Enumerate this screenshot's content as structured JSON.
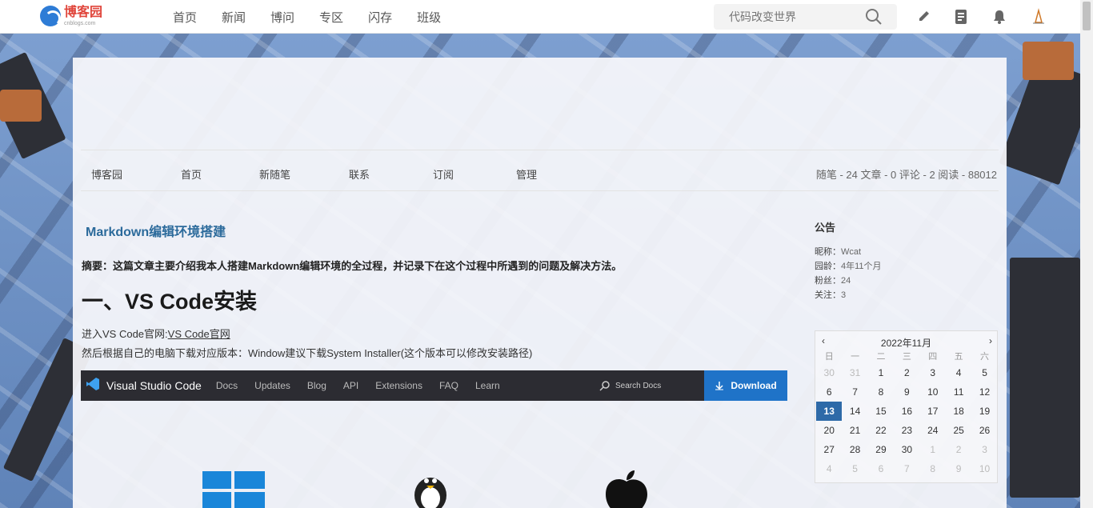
{
  "header": {
    "logo_cn": "博客园",
    "logo_en": "cnblogs.com",
    "nav": [
      "首页",
      "新闻",
      "博问",
      "专区",
      "闪存",
      "班级"
    ],
    "search_placeholder": "代码改变世界"
  },
  "blog_nav": {
    "items": [
      "博客园",
      "首页",
      "新随笔",
      "联系",
      "订阅",
      "管理"
    ],
    "stats": "随笔 - 24  文章 - 0  评论 - 2  阅读 - 88012"
  },
  "post": {
    "title": "Markdown编辑环境搭建",
    "abstract": "摘要：这篇文章主要介绍我本人搭建Markdown编辑环境的全过程，并记录下在这个过程中所遇到的问题及解决方法。",
    "heading": "一、VS Code安装",
    "line1_prefix": "进入VS Code官网:",
    "line1_link": "VS Code官网",
    "line2": "然后根据自己的电脑下载对应版本：Window建议下载System Installer(这个版本可以修改安装路径)"
  },
  "vscode_bar": {
    "title": "Visual Studio Code",
    "links": [
      "Docs",
      "Updates",
      "Blog",
      "API",
      "Extensions",
      "FAQ",
      "Learn"
    ],
    "search": "Search Docs",
    "download": "Download"
  },
  "sidebar": {
    "notice_title": "公告",
    "profile": [
      {
        "label": "昵称：",
        "value": "Wcat"
      },
      {
        "label": "园龄：",
        "value": "4年11个月"
      },
      {
        "label": "粉丝：",
        "value": "24"
      },
      {
        "label": "关注：",
        "value": "3"
      }
    ]
  },
  "calendar": {
    "prev": "‹",
    "next": "›",
    "month": "2022年11月",
    "weekdays": [
      "日",
      "一",
      "二",
      "三",
      "四",
      "五",
      "六"
    ],
    "weeks": [
      [
        "30",
        "31",
        "1",
        "2",
        "3",
        "4",
        "5"
      ],
      [
        "6",
        "7",
        "8",
        "9",
        "10",
        "11",
        "12"
      ],
      [
        "13",
        "14",
        "15",
        "16",
        "17",
        "18",
        "19"
      ],
      [
        "20",
        "21",
        "22",
        "23",
        "24",
        "25",
        "26"
      ],
      [
        "27",
        "28",
        "29",
        "30",
        "1",
        "2",
        "3"
      ],
      [
        "4",
        "5",
        "6",
        "7",
        "8",
        "9",
        "10"
      ]
    ],
    "today": "13"
  },
  "colors": {
    "accent": "#2b6a9b",
    "today_bg": "#2e6aa8",
    "vscode_blue": "#1f73c8",
    "logo_red": "#e0463c"
  }
}
